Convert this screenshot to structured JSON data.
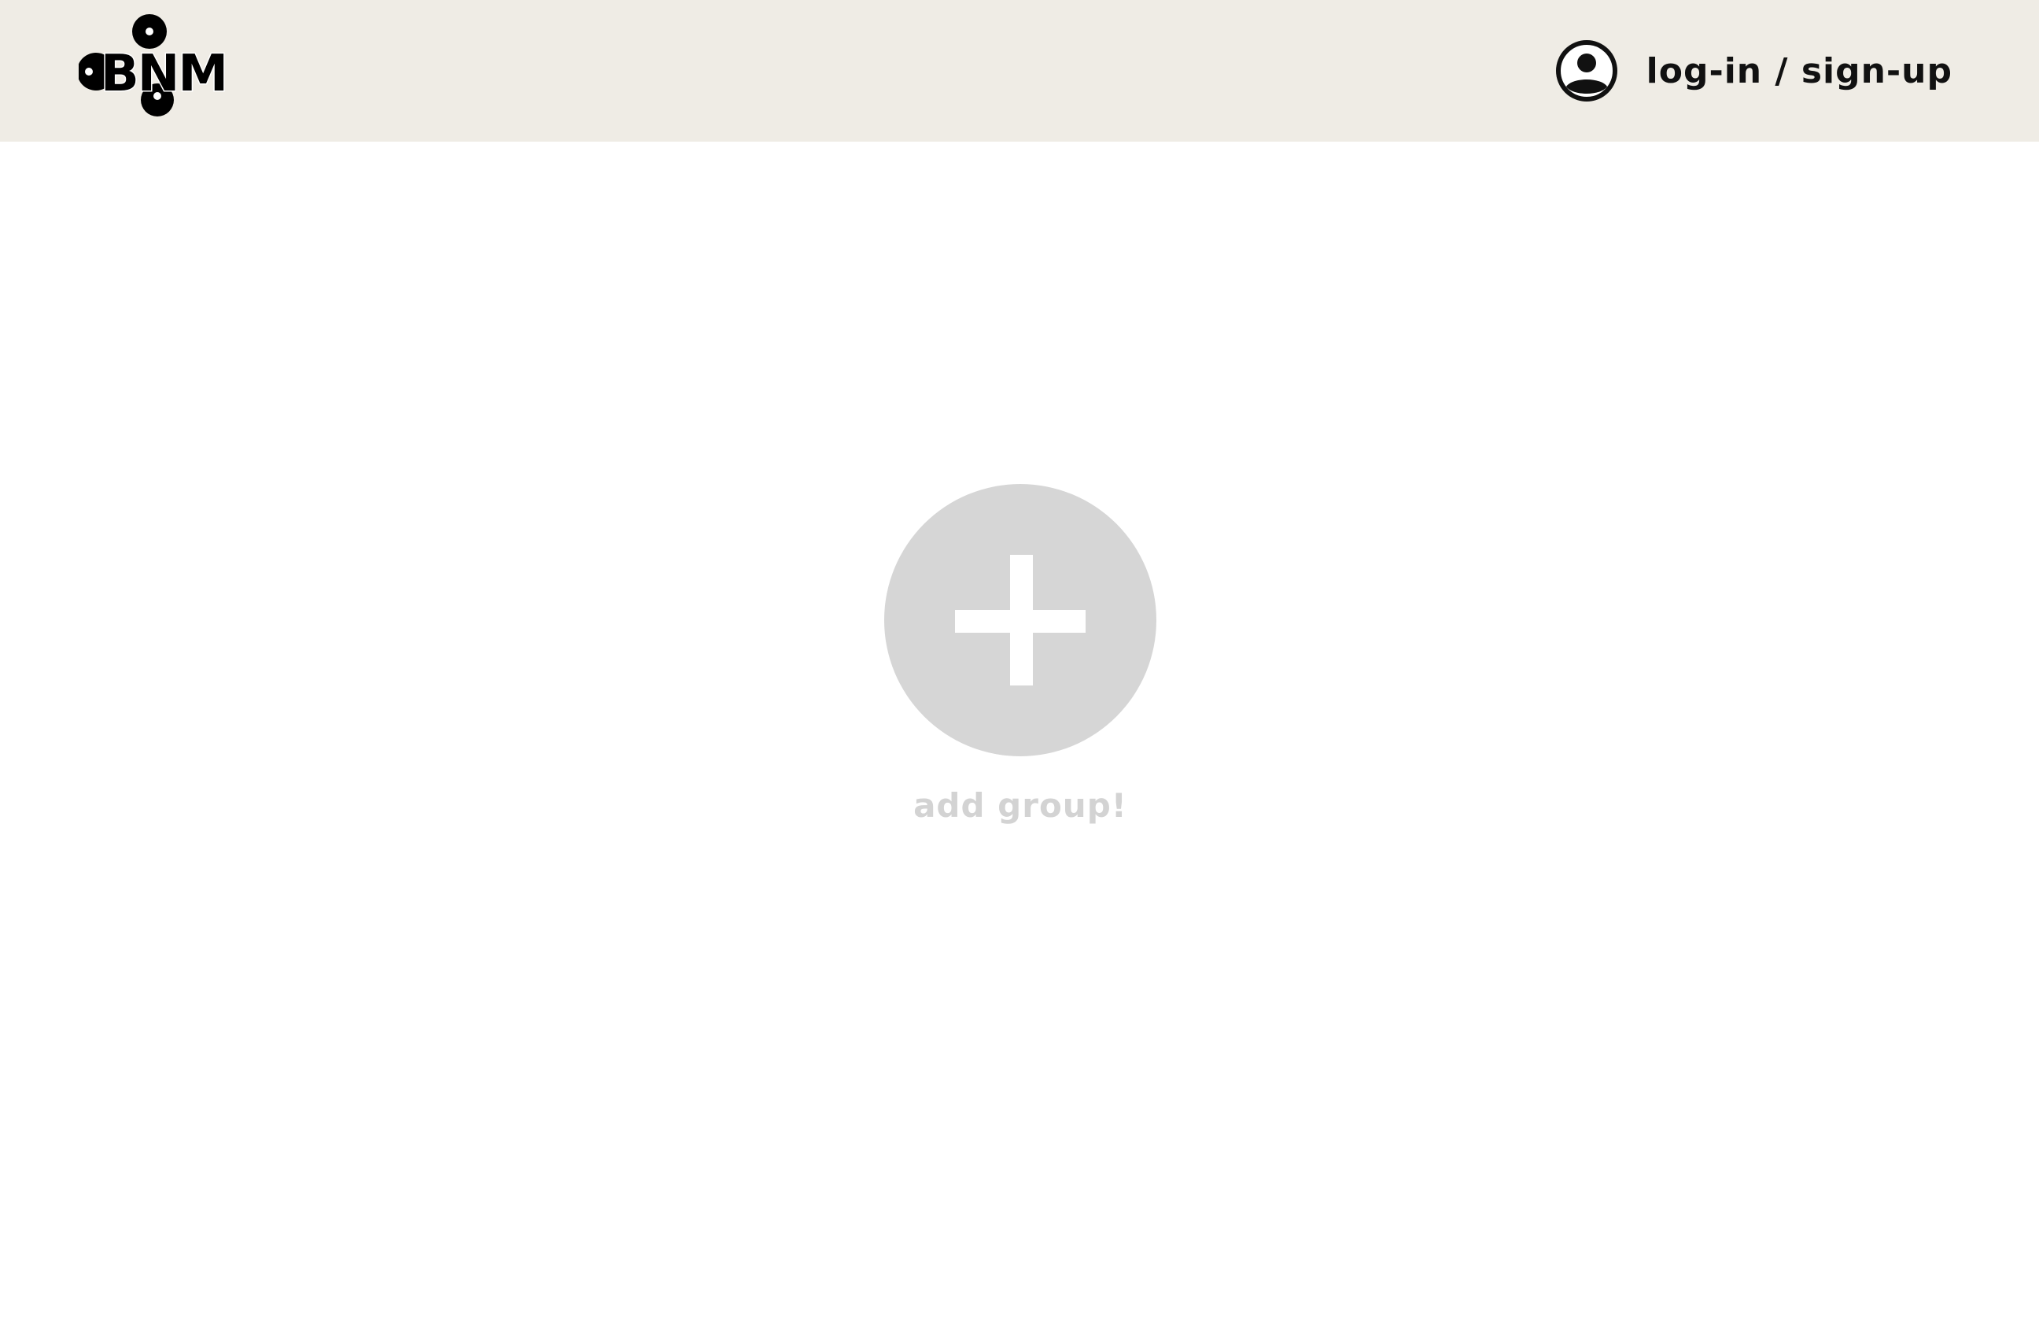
{
  "header": {
    "logo_text": "BNM",
    "auth_label": "log-in / sign-up",
    "auth_icon": "user-circle-icon",
    "background": "#efece5"
  },
  "main": {
    "add_group_label": "add group!",
    "add_icon": "plus-icon",
    "circle_color": "#d6d6d6",
    "label_color": "#d3d3d3"
  }
}
